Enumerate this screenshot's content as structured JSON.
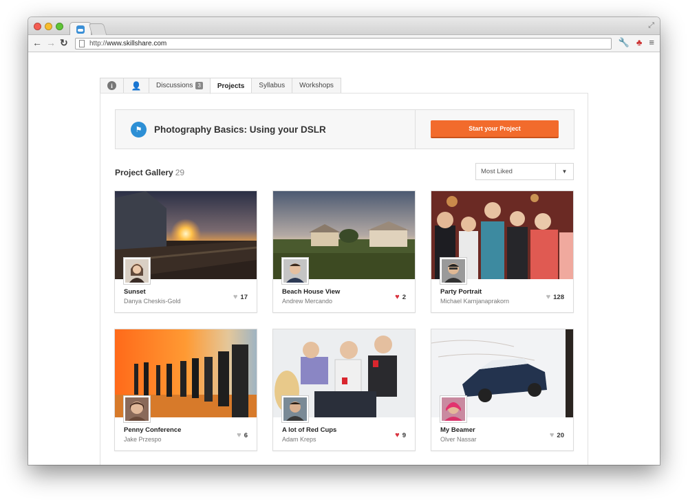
{
  "browser": {
    "url_protocol": "http://",
    "url_host": "www.skillshare.com"
  },
  "tabs": {
    "discussions_label": "Discussions",
    "discussions_count": "3",
    "projects_label": "Projects",
    "syllabus_label": "Syllabus",
    "workshops_label": "Workshops"
  },
  "banner": {
    "title": "Photography Basics: Using your DSLR",
    "button_label": "Start your Project"
  },
  "gallery": {
    "title": "Project Gallery",
    "count": "29",
    "sort_selected": "Most Liked"
  },
  "projects": [
    {
      "title": "Sunset",
      "author": "Danya Cheskis-Gold",
      "likes": "17",
      "liked": false
    },
    {
      "title": "Beach House View",
      "author": "Andrew Mercando",
      "likes": "2",
      "liked": true
    },
    {
      "title": "Party Portrait",
      "author": "Michael Karnjanaprakorn",
      "likes": "128",
      "liked": false
    },
    {
      "title": "Penny Conference",
      "author": "Jake Przespo",
      "likes": "6",
      "liked": false
    },
    {
      "title": "A lot of Red Cups",
      "author": "Adam Kreps",
      "likes": "9",
      "liked": true
    },
    {
      "title": "My Beamer",
      "author": "Olver Nassar",
      "likes": "20",
      "liked": false
    }
  ],
  "colors": {
    "accent_orange": "#f26b2c",
    "flag_blue": "#2d8fd5",
    "heart_red": "#d9333f",
    "heart_grey": "#bbbbbb"
  }
}
